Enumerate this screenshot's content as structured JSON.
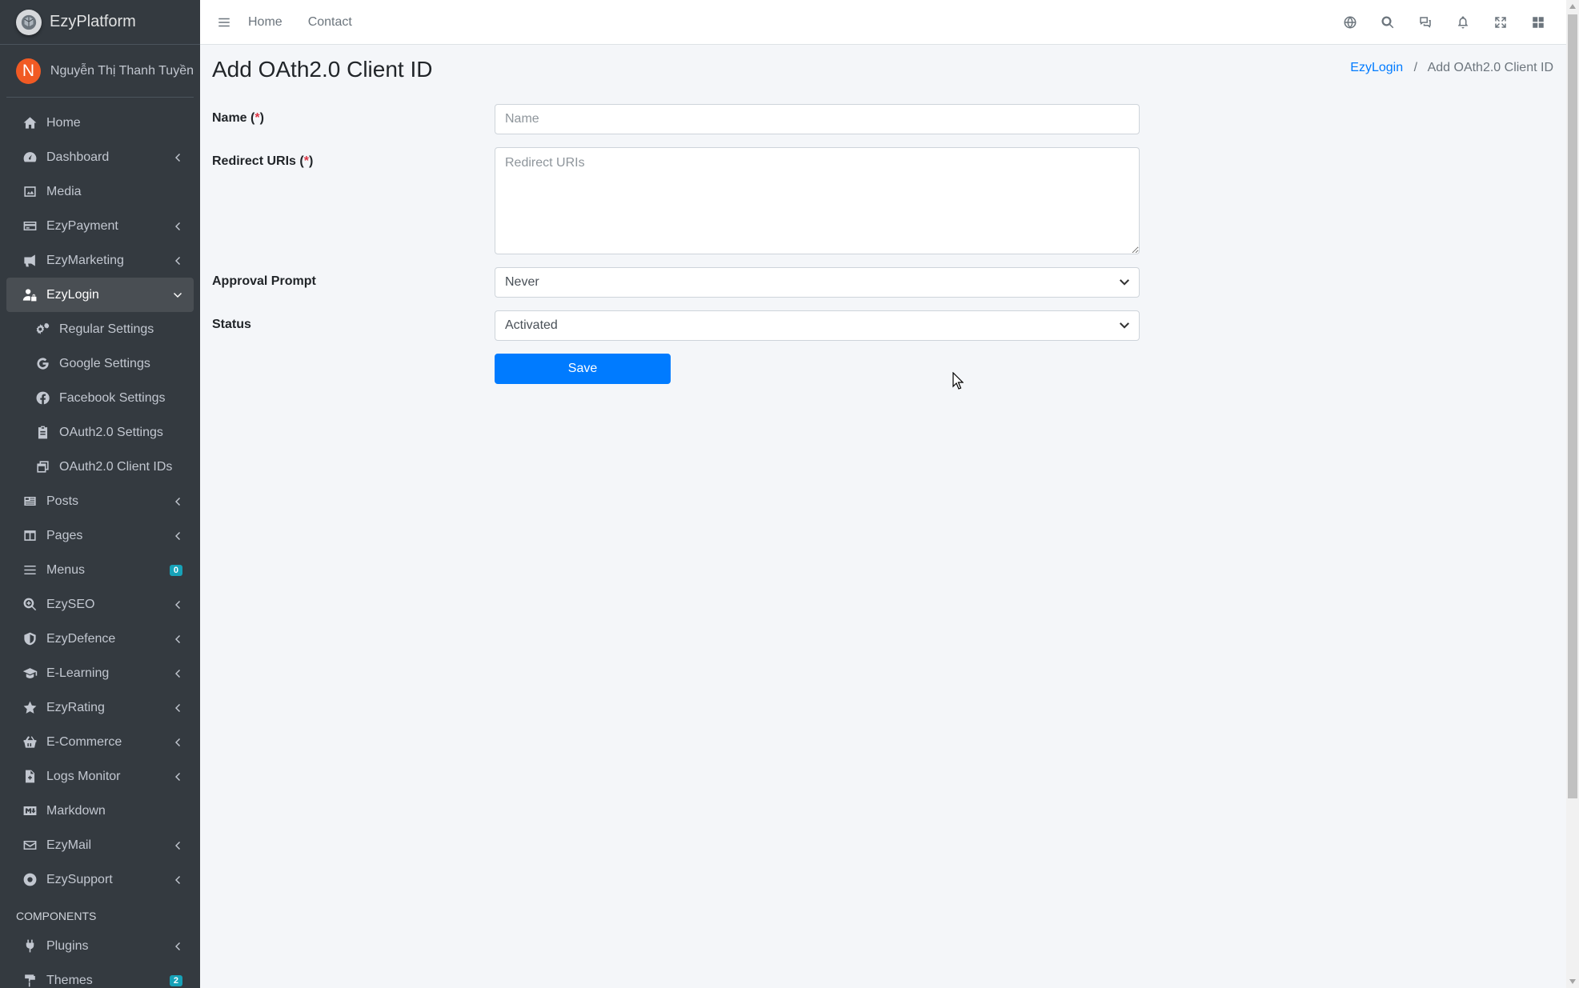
{
  "brand": {
    "name": "EzyPlatform"
  },
  "user": {
    "initial": "N",
    "name": "Nguyễn Thị Thanh Tuyền"
  },
  "sidebar": {
    "items": [
      {
        "label": "Home",
        "icon": "home-icon"
      },
      {
        "label": "Dashboard",
        "icon": "dashboard-icon"
      },
      {
        "label": "Media",
        "icon": "image-icon"
      },
      {
        "label": "EzyPayment",
        "icon": "credit-card-icon"
      },
      {
        "label": "EzyMarketing",
        "icon": "megaphone-icon"
      },
      {
        "label": "EzyLogin",
        "icon": "user-lock-icon"
      },
      {
        "label": "Regular Settings",
        "icon": "cogs-icon"
      },
      {
        "label": "Google Settings",
        "icon": "google-icon"
      },
      {
        "label": "Facebook Settings",
        "icon": "facebook-icon"
      },
      {
        "label": "OAuth2.0 Settings",
        "icon": "clipboard-icon"
      },
      {
        "label": "OAuth2.0 Client IDs",
        "icon": "window-restore-icon"
      },
      {
        "label": "Posts",
        "icon": "newspaper-icon"
      },
      {
        "label": "Pages",
        "icon": "columns-icon"
      },
      {
        "label": "Menus",
        "icon": "bars-icon",
        "badge": "0"
      },
      {
        "label": "EzySEO",
        "icon": "search-plus-icon"
      },
      {
        "label": "EzyDefence",
        "icon": "shield-icon"
      },
      {
        "label": "E-Learning",
        "icon": "graduation-cap-icon"
      },
      {
        "label": "EzyRating",
        "icon": "star-icon"
      },
      {
        "label": "E-Commerce",
        "icon": "basket-icon"
      },
      {
        "label": "Logs Monitor",
        "icon": "file-medical-icon"
      },
      {
        "label": "Markdown",
        "icon": "markdown-icon"
      },
      {
        "label": "EzyMail",
        "icon": "envelope-icon"
      },
      {
        "label": "EzySupport",
        "icon": "life-ring-icon"
      }
    ],
    "section_header": "COMPONENTS",
    "components": [
      {
        "label": "Plugins",
        "icon": "plug-icon"
      },
      {
        "label": "Themes",
        "icon": "paint-icon",
        "badge": "2"
      }
    ]
  },
  "topbar": {
    "links": [
      "Home",
      "Contact"
    ]
  },
  "page": {
    "title": "Add OAth2.0 Client ID",
    "breadcrumb": {
      "parent": "EzyLogin",
      "separator": "/",
      "current": "Add OAth2.0 Client ID"
    }
  },
  "form": {
    "name_label": "Name (",
    "required_mark": "*",
    "label_close": ")",
    "name_placeholder": "Name",
    "redirect_label": "Redirect URIs (",
    "redirect_placeholder": "Redirect URIs",
    "approval_label": "Approval Prompt",
    "approval_value": "Never",
    "status_label": "Status",
    "status_value": "Activated",
    "save_label": "Save"
  }
}
